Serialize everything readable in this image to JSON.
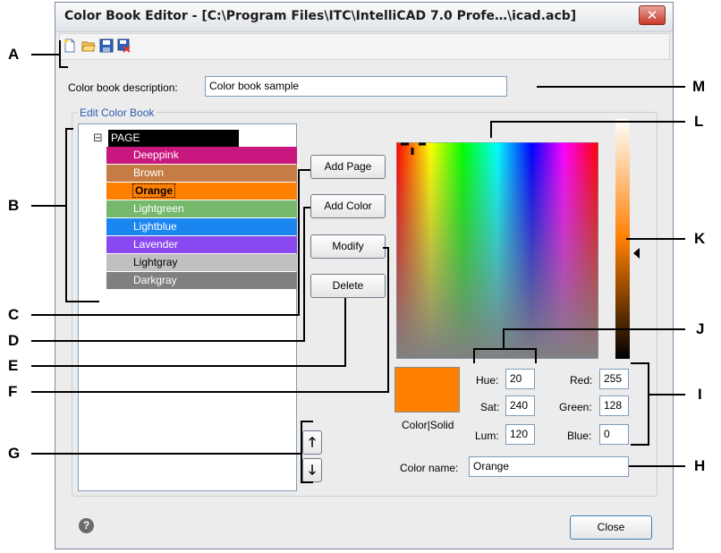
{
  "window": {
    "title": "Color Book Editor - [C:\\Program Files\\ITC\\IntelliCAD 7.0 Profe…\\icad.acb]",
    "close_glyph": "✕"
  },
  "toolbar": {
    "icons": [
      "new-icon",
      "open-icon",
      "save-icon",
      "save-as-icon"
    ]
  },
  "description": {
    "label": "Color book description:",
    "value": "Color book sample"
  },
  "group": {
    "label": "Edit Color Book"
  },
  "tree": {
    "root_label": "PAGE",
    "collapse_glyph": "⊟",
    "items": [
      {
        "label": "Deeppink",
        "color": "#c8177f",
        "text_color": "#ffffff"
      },
      {
        "label": "Brown",
        "color": "#c67d45",
        "text_color": "#ffffff"
      },
      {
        "label": "Orange",
        "color": "#ff8000",
        "text_color": "#000000",
        "selected": true
      },
      {
        "label": "Lightgreen",
        "color": "#76b96c",
        "text_color": "#ffffff"
      },
      {
        "label": "Lightblue",
        "color": "#1c86f0",
        "text_color": "#ffffff"
      },
      {
        "label": "Lavender",
        "color": "#8a49f0",
        "text_color": "#ffffff"
      },
      {
        "label": "Lightgray",
        "color": "#c0c0c0",
        "text_color": "#000000"
      },
      {
        "label": "Darkgray",
        "color": "#808080",
        "text_color": "#ffffff"
      }
    ]
  },
  "buttons": {
    "add_page": "Add Page",
    "add_color": "Add Color",
    "modify": "Modify",
    "delete": "Delete",
    "close": "Close",
    "move_up": "🡑",
    "move_down": "🡓"
  },
  "color_preview": {
    "color": "#ff8000",
    "label": "Color|Solid"
  },
  "hsl": {
    "hue_label": "Hue:",
    "hue": "20",
    "sat_label": "Sat:",
    "sat": "240",
    "lum_label": "Lum:",
    "lum": "120"
  },
  "rgb": {
    "red_label": "Red:",
    "red": "255",
    "green_label": "Green:",
    "green": "128",
    "blue_label": "Blue:",
    "blue": "0"
  },
  "color_name": {
    "label": "Color name:",
    "value": "Orange"
  },
  "help_glyph": "?",
  "callouts": [
    "A",
    "B",
    "C",
    "D",
    "E",
    "F",
    "G",
    "H",
    "I",
    "J",
    "K",
    "L",
    "M"
  ]
}
